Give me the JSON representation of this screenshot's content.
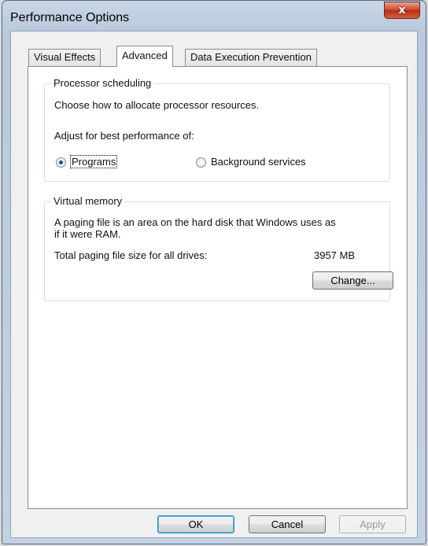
{
  "window": {
    "title": "Performance Options",
    "close_glyph": "x"
  },
  "tabs": [
    {
      "label": "Visual Effects"
    },
    {
      "label": "Advanced"
    },
    {
      "label": "Data Execution Prevention"
    }
  ],
  "active_tab": "Advanced",
  "processor_scheduling": {
    "legend": "Processor scheduling",
    "description": "Choose how to allocate processor resources.",
    "adjust_label": "Adjust for best performance of:",
    "options": [
      {
        "label": "Programs",
        "checked": true
      },
      {
        "label": "Background services",
        "checked": false
      }
    ]
  },
  "virtual_memory": {
    "legend": "Virtual memory",
    "description_line1": "A paging file is an area on the hard disk that Windows uses as",
    "description_line2": "if it were RAM.",
    "total_label": "Total paging file size for all drives:",
    "total_value": "3957 MB",
    "change_label": "Change..."
  },
  "buttons": {
    "ok": "OK",
    "cancel": "Cancel",
    "apply": "Apply",
    "apply_enabled": false
  },
  "colors": {
    "close_button": "#c9442a",
    "default_button_border": "#3c7fb1",
    "radio_dot": "#1f4f94"
  }
}
